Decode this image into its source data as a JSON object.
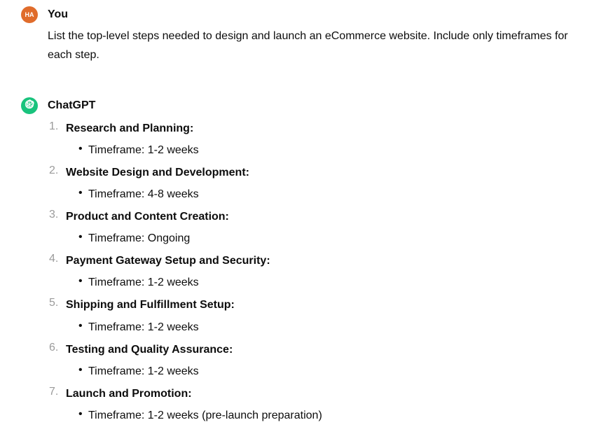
{
  "user": {
    "avatar_initials": "HA",
    "author_label": "You",
    "message": "List the top-level steps needed to design and launch an eCommerce website. Include only timeframes for each step."
  },
  "assistant": {
    "author_label": "ChatGPT",
    "steps": [
      {
        "title": "Research and Planning:",
        "timeframe": "Timeframe: 1-2 weeks"
      },
      {
        "title": "Website Design and Development:",
        "timeframe": "Timeframe: 4-8 weeks"
      },
      {
        "title": "Product and Content Creation:",
        "timeframe": "Timeframe: Ongoing"
      },
      {
        "title": "Payment Gateway Setup and Security:",
        "timeframe": "Timeframe: 1-2 weeks"
      },
      {
        "title": "Shipping and Fulfillment Setup:",
        "timeframe": "Timeframe: 1-2 weeks"
      },
      {
        "title": "Testing and Quality Assurance:",
        "timeframe": "Timeframe: 1-2 weeks"
      },
      {
        "title": "Launch and Promotion:",
        "timeframe": "Timeframe: 1-2 weeks (pre-launch preparation)"
      }
    ]
  }
}
